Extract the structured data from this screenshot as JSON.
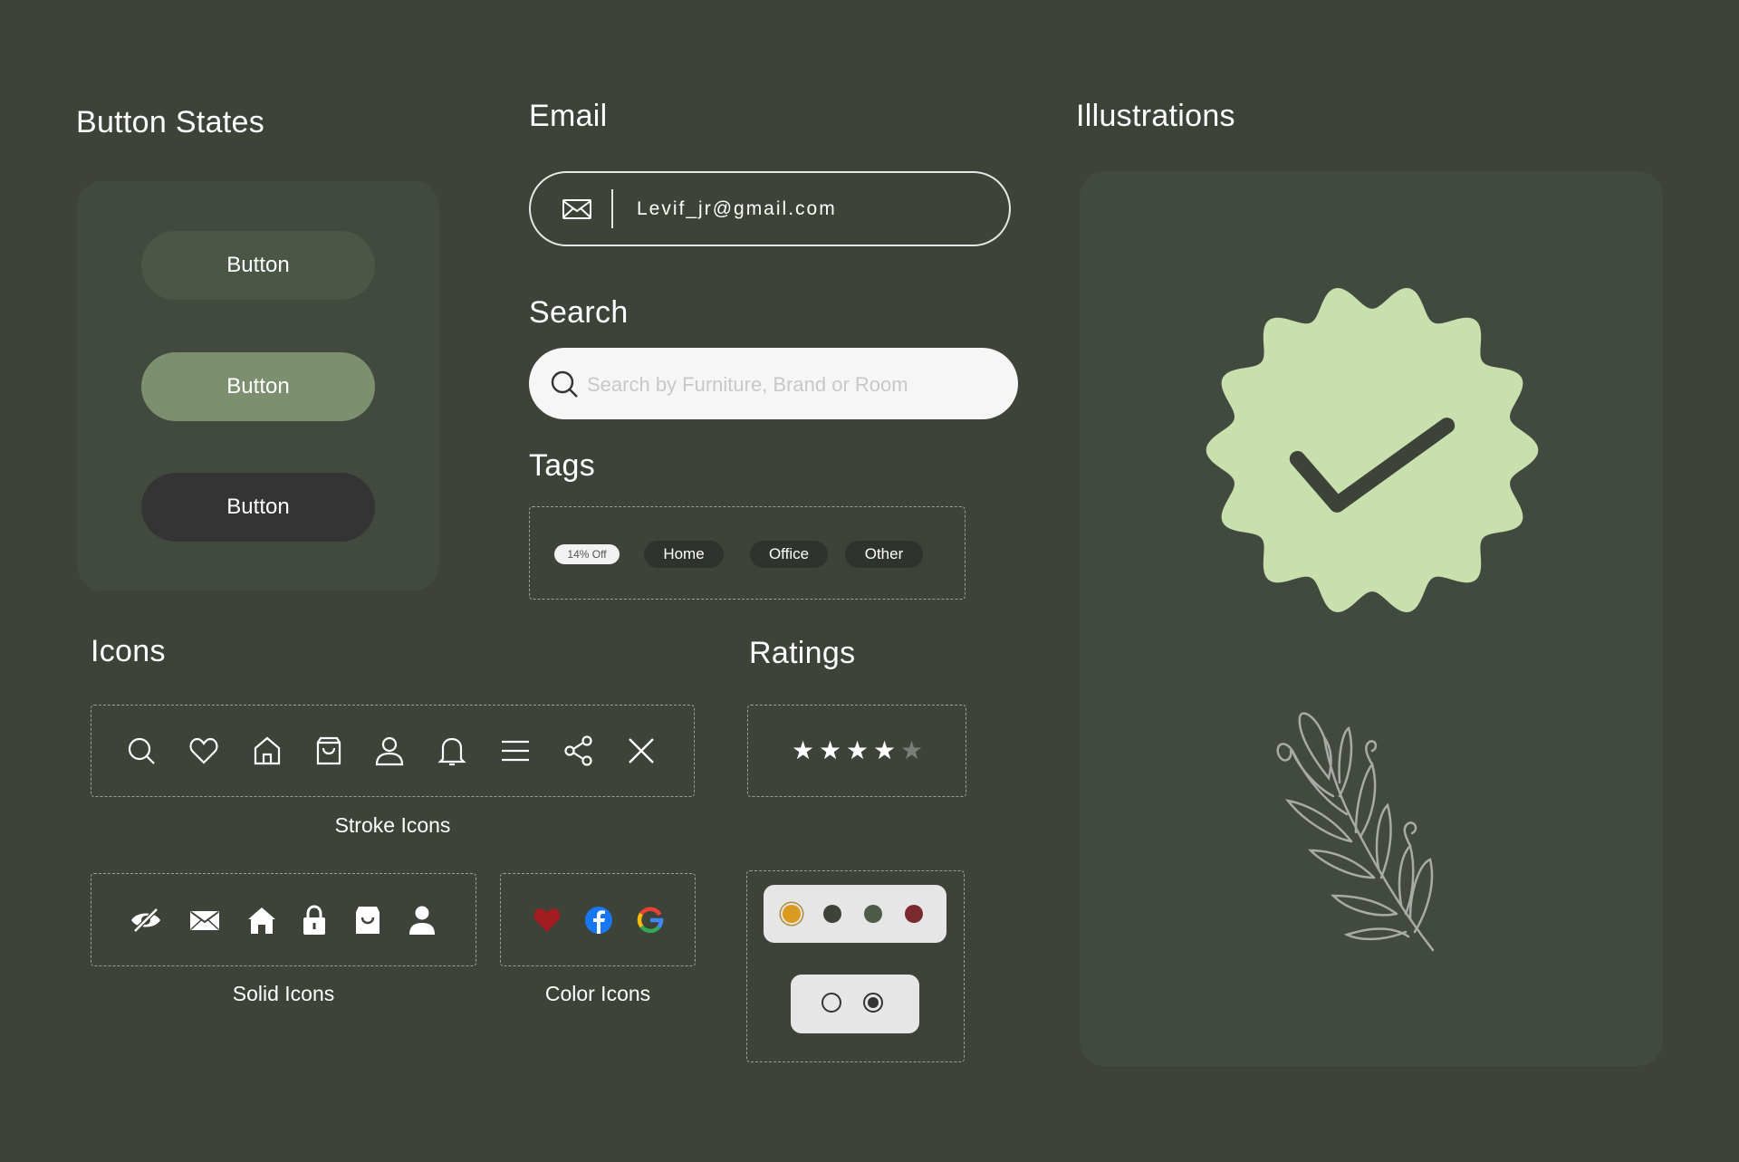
{
  "colors": {
    "background": "#3d4339",
    "panel": "#424a3f",
    "button_default": "#4b5646",
    "button_hover": "#7c8f6f",
    "button_dark": "#343434",
    "badge_green": "#c8e0ad",
    "badge_check": "#3d4339"
  },
  "button_states": {
    "heading": "Button States",
    "buttons": [
      "Button",
      "Button",
      "Button"
    ]
  },
  "email": {
    "heading": "Email",
    "value": "Levif_jr@gmail.com",
    "icon": "mail-icon"
  },
  "search": {
    "heading": "Search",
    "placeholder": "Search by Furniture, Brand or Room",
    "icon": "search-icon"
  },
  "tags": {
    "heading": "Tags",
    "items": [
      "14% Off",
      "Home",
      "Office",
      "Other"
    ]
  },
  "icons": {
    "heading": "Icons",
    "stroke_caption": "Stroke Icons",
    "stroke": [
      "search-icon",
      "heart-icon",
      "home-icon",
      "shopping-bag-icon",
      "user-icon",
      "bell-icon",
      "menu-icon",
      "share-icon",
      "close-icon"
    ],
    "solid_caption": "Solid Icons",
    "solid": [
      "eye-off-icon",
      "mail-icon",
      "home-icon",
      "lock-icon",
      "shopping-bag-icon",
      "user-icon"
    ],
    "color_caption": "Color Icons",
    "color": [
      "heart-icon",
      "facebook-icon",
      "google-icon"
    ]
  },
  "ratings": {
    "heading": "Ratings",
    "value": 4,
    "max": 5,
    "star_glyph": "★",
    "swatches": [
      "#d99a1e",
      "#3d4339",
      "#4d5b47",
      "#7a2a2e"
    ],
    "selected_swatch": 0,
    "radios": [
      false,
      true
    ]
  },
  "illustrations": {
    "heading": "Illustrations",
    "items": [
      "verified-badge-icon",
      "leaf-branch-icon"
    ]
  }
}
